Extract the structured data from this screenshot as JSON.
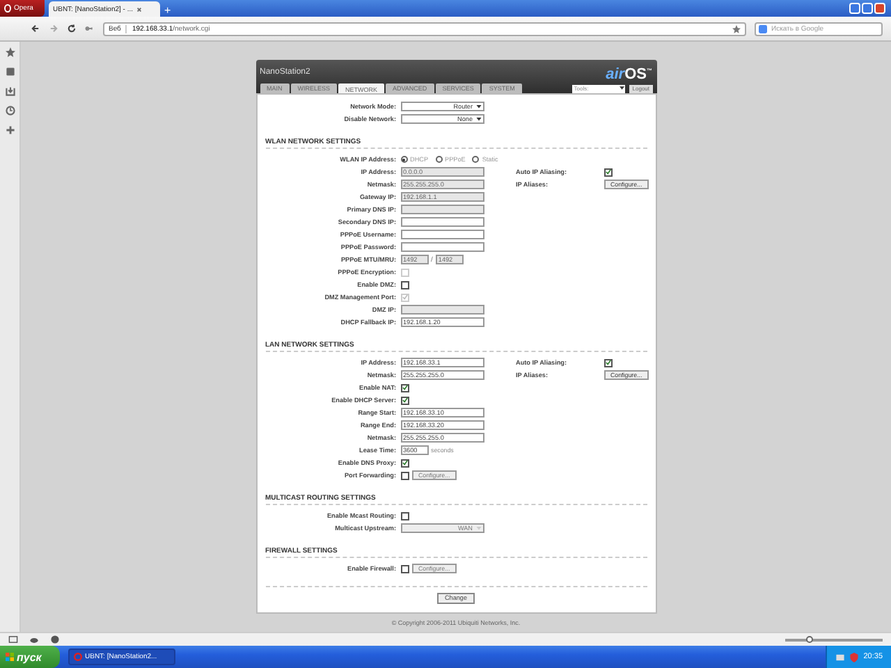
{
  "browser": {
    "menu_button": "Opera",
    "tab_title": "UBNT: [NanoStation2] - ...",
    "badge": "Веб",
    "url_host": "192.168.33.1",
    "url_path": "/network.cgi",
    "search_placeholder": "Искать в Google",
    "new_tab": "+",
    "zoom": {
      "level": 0.22
    }
  },
  "page": {
    "device": "NanoStation2",
    "logo_prefix": "air",
    "logo": "OS",
    "logo_mark": "™",
    "tools": "Tools:",
    "logout": "Logout",
    "tabs": [
      {
        "label": "MAIN",
        "selected": false
      },
      {
        "label": "WIRELESS",
        "selected": false
      },
      {
        "label": "NETWORK",
        "selected": true
      },
      {
        "label": "ADVANCED",
        "selected": false
      },
      {
        "label": "SERVICES",
        "selected": false
      },
      {
        "label": "SYSTEM",
        "selected": false
      }
    ],
    "top_rows": [
      {
        "kind": "select",
        "label": "Network Mode:",
        "value": "Router",
        "disabled": false
      },
      {
        "kind": "select",
        "label": "Disable Network:",
        "value": "None",
        "disabled": false
      }
    ],
    "sections": [
      {
        "title": "WLAN NETWORK SETTINGS",
        "rows": [
          {
            "kind": "radio",
            "label": "WLAN IP Address:",
            "options": [
              {
                "label": "DHCP",
                "selected": true
              },
              {
                "label": "PPPoE",
                "selected": false
              },
              {
                "label": "Static",
                "selected": false
              }
            ]
          },
          {
            "kind": "input",
            "label": "IP Address:",
            "value": "0.0.0.0",
            "disabled": true,
            "side": {
              "kind": "checkbox",
              "label": "Auto IP Aliasing:",
              "checked": true
            }
          },
          {
            "kind": "input",
            "label": "Netmask:",
            "value": "255.255.255.0",
            "disabled": true,
            "side": {
              "kind": "button",
              "label": "IP Aliases:",
              "text": "Configure..."
            }
          },
          {
            "kind": "input",
            "label": "Gateway IP:",
            "value": "192.168.1.1",
            "disabled": true
          },
          {
            "kind": "input",
            "label": "Primary DNS IP:",
            "disabled": true
          },
          {
            "kind": "input",
            "label": "Secondary DNS IP:",
            "disabled": false
          },
          {
            "kind": "input",
            "label": "PPPoE Username:",
            "disabled": false
          },
          {
            "kind": "input",
            "label": "PPPoE Password:",
            "disabled": false
          },
          {
            "kind": "pair",
            "label": "PPPoE MTU/MRU:",
            "values": [
              "1492",
              "1492"
            ],
            "separator": "/",
            "disabled": true
          },
          {
            "kind": "checkbox",
            "label": "PPPoE Encryption:",
            "checked": false,
            "disabled": true
          },
          {
            "kind": "checkbox",
            "label": "Enable DMZ:",
            "checked": false,
            "disabled": false
          },
          {
            "kind": "checkbox",
            "label": "DMZ Management Port:",
            "checked": true,
            "disabled": true
          },
          {
            "kind": "input",
            "label": "DMZ IP:",
            "disabled": true
          },
          {
            "kind": "input",
            "label": "DHCP Fallback IP:",
            "value": "192.168.1.20",
            "disabled": false
          }
        ]
      },
      {
        "title": "LAN NETWORK SETTINGS",
        "rows": [
          {
            "kind": "input",
            "label": "IP Address:",
            "value": "192.168.33.1",
            "disabled": false,
            "side": {
              "kind": "checkbox",
              "label": "Auto IP Aliasing:",
              "checked": true
            }
          },
          {
            "kind": "input",
            "label": "Netmask:",
            "value": "255.255.255.0",
            "disabled": false,
            "side": {
              "kind": "button",
              "label": "IP Aliases:",
              "text": "Configure..."
            }
          },
          {
            "kind": "checkbox",
            "label": "Enable NAT:",
            "checked": true,
            "disabled": false
          },
          {
            "kind": "checkbox",
            "label": "Enable DHCP Server:",
            "checked": true,
            "disabled": false
          },
          {
            "kind": "input",
            "label": "Range Start:",
            "value": "192.168.33.10",
            "disabled": false
          },
          {
            "kind": "input",
            "label": "Range End:",
            "value": "192.168.33.20",
            "disabled": false
          },
          {
            "kind": "input",
            "label": "Netmask:",
            "value": "255.255.255.0",
            "disabled": false
          },
          {
            "kind": "unit",
            "label": "Lease Time:",
            "value": "3600",
            "unit": "seconds"
          },
          {
            "kind": "checkbox",
            "label": "Enable DNS Proxy:",
            "checked": true,
            "disabled": false
          },
          {
            "kind": "checkbox",
            "label": "Port Forwarding:",
            "checked": false,
            "disabled": false,
            "button": "Configure..."
          }
        ]
      },
      {
        "title": "MULTICAST ROUTING SETTINGS",
        "rows": [
          {
            "kind": "checkbox",
            "label": "Enable Mcast Routing:",
            "checked": false,
            "disabled": false
          },
          {
            "kind": "select",
            "label": "Multicast Upstream:",
            "value": "WAN",
            "disabled": true
          }
        ]
      },
      {
        "title": "FIREWALL SETTINGS",
        "rows": [
          {
            "kind": "checkbox",
            "label": "Enable Firewall:",
            "checked": false,
            "disabled": false,
            "button": "Configure..."
          }
        ]
      }
    ],
    "change": "Change",
    "copyright": "© Copyright 2006-2011 Ubiquiti Networks, Inc."
  },
  "taskbar": {
    "start": "пуск",
    "task": "UBNT: [NanoStation2...",
    "clock": "20:35"
  }
}
